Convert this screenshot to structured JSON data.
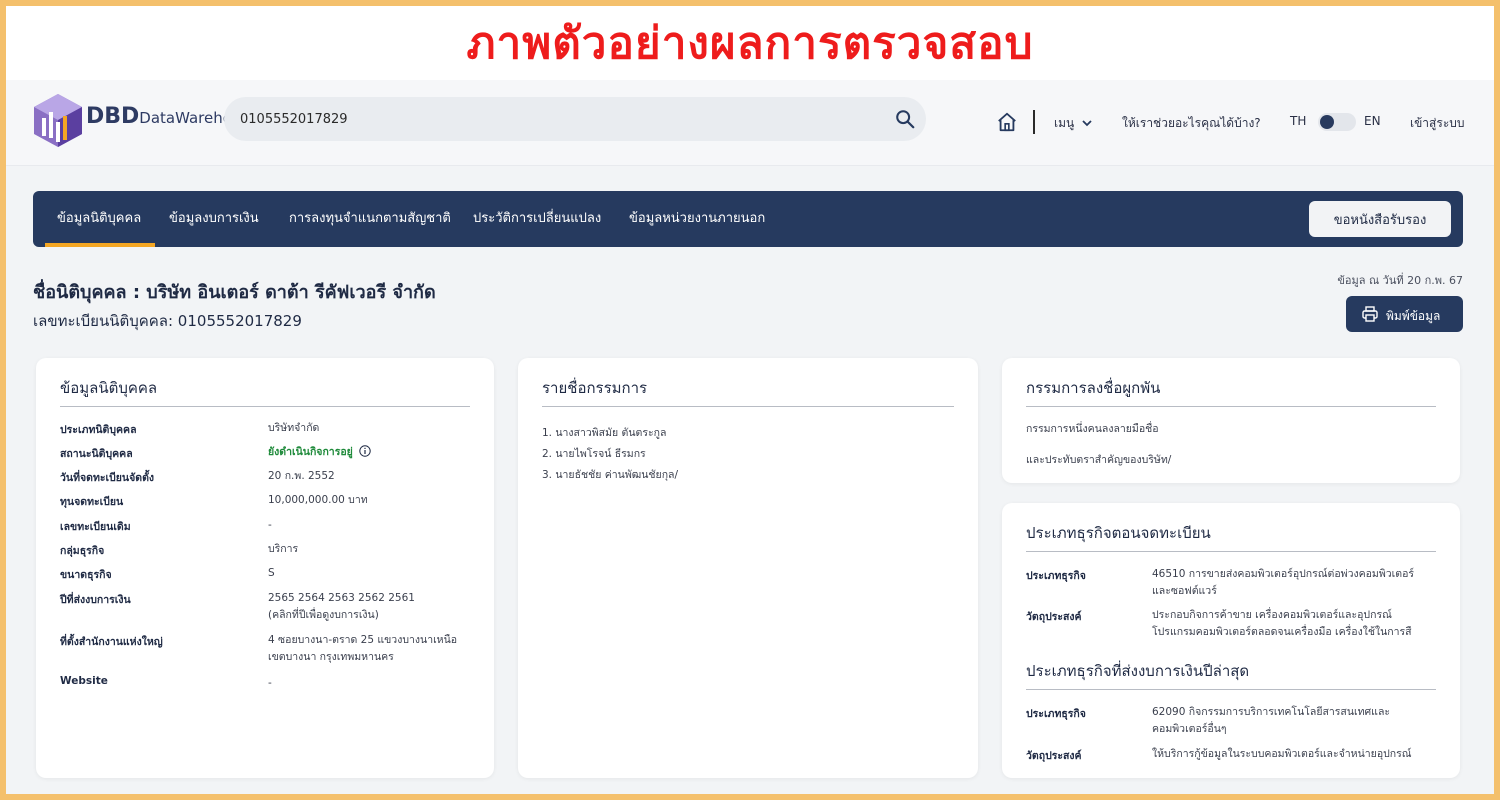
{
  "banner": {
    "title": "ภาพตัวอย่างผลการตรวจสอบ"
  },
  "logo": {
    "letters": "DBD",
    "text": "DataWarehouse",
    "plus": "+"
  },
  "search": {
    "value": "0105552017829"
  },
  "nav": {
    "menu_label": "เมนู",
    "help_label": "ให้เราช่วยอะไรคุณได้บ้าง?",
    "lang_th": "TH",
    "lang_en": "EN",
    "login_label": "เข้าสู่ระบบ"
  },
  "tabs": {
    "items": [
      "ข้อมูลนิติบุคคล",
      "ข้อมูลงบการเงิน",
      "การลงทุนจำแนกตามสัญชาติ",
      "ประวัติการเปลี่ยนแปลง",
      "ข้อมูลหน่วยงานภายนอก"
    ],
    "cert_button": "ขอหนังสือรับรอง"
  },
  "header": {
    "company_name": "ชื่อนิติบุคคล : บริษัท อินเตอร์ ดาต้า รีคัฟเวอรี จำกัด",
    "reg_no": "เลขทะเบียนนิติบุคคล: 0105552017829",
    "as_of": "ข้อมูล ณ วันที่ 20 ก.พ. 67",
    "print_button": "พิมพ์ข้อมูล"
  },
  "company_card": {
    "title": "ข้อมูลนิติบุคคล",
    "rows": [
      {
        "label": "ประเภทนิติบุคคล",
        "value": "บริษัทจำกัด"
      },
      {
        "label": "สถานะนิติบุคคล",
        "value": "ยังดำเนินกิจการอยู่"
      },
      {
        "label": "วันที่จดทะเบียนจัดตั้ง",
        "value": "20 ก.พ. 2552"
      },
      {
        "label": "ทุนจดทะเบียน",
        "value": "10,000,000.00 บาท"
      },
      {
        "label": "เลขทะเบียนเดิม",
        "value": "-"
      },
      {
        "label": "กลุ่มธุรกิจ",
        "value": "บริการ"
      },
      {
        "label": "ขนาดธุรกิจ",
        "value": "S"
      },
      {
        "label": "ปีที่ส่งงบการเงิน",
        "value": "2565  2564  2563  2562  2561",
        "note": "(คลิกที่ปีเพื่อดูงบการเงิน)"
      },
      {
        "label": "ที่ตั้งสำนักงานแห่งใหญ่",
        "value": "4 ซอยบางนา-ตราด 25 แขวงบางนาเหนือ",
        "note": "เขตบางนา กรุงเทพมหานคร"
      },
      {
        "label": "Website",
        "value": "-"
      }
    ]
  },
  "directors_card": {
    "title": "รายชื่อกรรมการ",
    "items": [
      "1. นางสาวพิสมัย ตันตระกูล",
      "2. นายไพโรจน์ ธีรมกร",
      "3. นายธัชชัย ค่านพัฒนชัยกุล/"
    ]
  },
  "signing_card": {
    "title": "กรรมการลงชื่อผูกพัน",
    "line1": "กรรมการหนึ่งคนลงลายมือชื่อ",
    "line2": "และประทับตราสำคัญของบริษัท/"
  },
  "business_card": {
    "title1": "ประเภทธุรกิจตอนจดทะเบียน",
    "reg": {
      "type_label": "ประเภทธุรกิจ",
      "type_value1": "46510 การขายส่งคอมพิวเตอร์อุปกรณ์ต่อพ่วงคอมพิวเตอร์",
      "type_value2": "และซอฟต์แวร์",
      "obj_label": "วัตถุประสงค์",
      "obj_value1": "ประกอบกิจการค้าขาย เครื่องคอมพิวเตอร์และอุปกรณ์",
      "obj_value2": "โปรแกรมคอมพิวเตอร์ตลอดจนเครื่องมือ เครื่องใช้ในการสื"
    },
    "title2": "ประเภทธุรกิจที่ส่งงบการเงินปีล่าสุด",
    "latest": {
      "type_label": "ประเภทธุรกิจ",
      "type_value1": "62090 กิจกรรมการบริการเทคโนโลยีสารสนเทศและ",
      "type_value2": "คอมพิวเตอร์อื่นๆ",
      "obj_label": "วัตถุประสงค์",
      "obj_value1": "ให้บริการกู้ข้อมูลในระบบคอมพิวเตอร์และจำหน่ายอุปกรณ์"
    }
  },
  "colors": {
    "navy": "#263a5f",
    "accent": "#f4a623",
    "banner_red": "#ee1c1c",
    "status_green": "#1e8a3a"
  }
}
